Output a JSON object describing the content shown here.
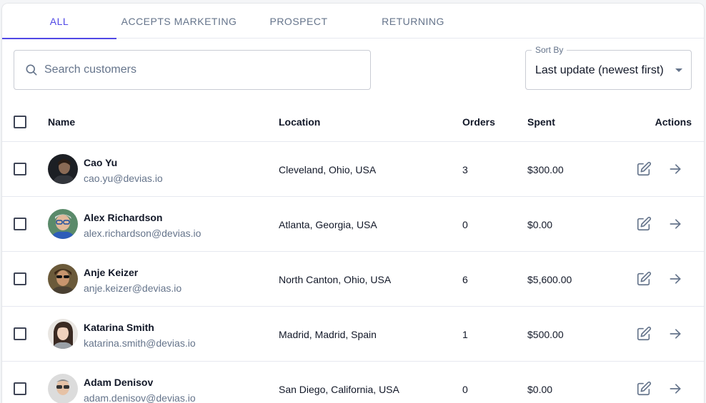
{
  "tabs": [
    {
      "label": "ALL",
      "active": true
    },
    {
      "label": "ACCEPTS MARKETING",
      "active": false
    },
    {
      "label": "PROSPECT",
      "active": false
    },
    {
      "label": "RETURNING",
      "active": false
    }
  ],
  "search": {
    "placeholder": "Search customers",
    "value": ""
  },
  "sort": {
    "label": "Sort By",
    "value": "Last update (newest first)"
  },
  "table": {
    "columns": {
      "name": "Name",
      "location": "Location",
      "orders": "Orders",
      "spent": "Spent",
      "actions": "Actions"
    },
    "rows": [
      {
        "name": "Cao Yu",
        "email": "cao.yu@devias.io",
        "location": "Cleveland, Ohio, USA",
        "orders": "3",
        "spent": "$300.00"
      },
      {
        "name": "Alex Richardson",
        "email": "alex.richardson@devias.io",
        "location": "Atlanta, Georgia, USA",
        "orders": "0",
        "spent": "$0.00"
      },
      {
        "name": "Anje Keizer",
        "email": "anje.keizer@devias.io",
        "location": "North Canton, Ohio, USA",
        "orders": "6",
        "spent": "$5,600.00"
      },
      {
        "name": "Katarina Smith",
        "email": "katarina.smith@devias.io",
        "location": "Madrid, Madrid, Spain",
        "orders": "1",
        "spent": "$500.00"
      },
      {
        "name": "Adam Denisov",
        "email": "adam.denisov@devias.io",
        "location": "San Diego, California, USA",
        "orders": "0",
        "spent": "$0.00"
      }
    ]
  },
  "icons": {
    "search": "search-icon",
    "edit": "edit-icon",
    "arrow": "arrow-right-icon",
    "caret": "caret-down-icon"
  },
  "colors": {
    "accent": "#5048e5",
    "muted": "#65748b",
    "text": "#121828",
    "divider": "#e6e8f0"
  }
}
